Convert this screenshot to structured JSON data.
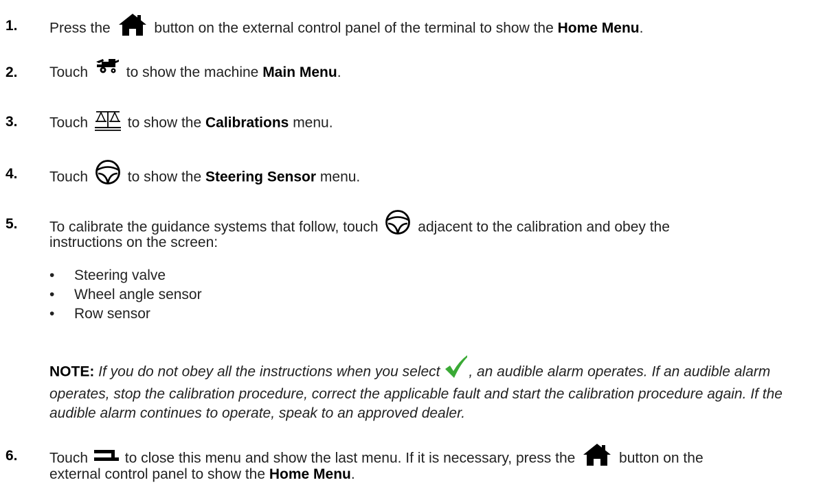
{
  "steps": [
    {
      "number": "1.",
      "parts": [
        "Press the",
        "button on the external control panel of the terminal to show the",
        "Home Menu",
        "."
      ],
      "icon": "home-icon"
    },
    {
      "number": "2.",
      "parts": [
        "Touch",
        "to show the machine",
        "Main Menu",
        "."
      ],
      "icon": "combine-harvester-icon"
    },
    {
      "number": "3.",
      "parts": [
        "Touch",
        "to show the",
        "Calibrations",
        "menu."
      ],
      "icon": "balance-scale-icon"
    },
    {
      "number": "4.",
      "parts": [
        "Touch",
        "to show the",
        "Steering Sensor",
        "menu."
      ],
      "icon": "steering-wheel-icon"
    },
    {
      "number": "5.",
      "parts": [
        "To calibrate the guidance systems that follow, touch",
        "adjacent to the calibration and obey the",
        "instructions on the screen:"
      ],
      "icon": "steering-wheel-icon",
      "bullets": [
        "Steering valve",
        "Wheel angle sensor",
        "Row sensor"
      ],
      "note": {
        "label": "NOTE:",
        "before_icon": "If you do not obey all the instructions when you select",
        "after_icon": ", an audible alarm operates. If an audible alarm operates, stop the calibration procedure, correct the applicable fault and start the calibration procedure again. If the audible alarm continues to operate, speak to an approved dealer.",
        "icon": "checkmark-icon"
      }
    },
    {
      "number": "6.",
      "parts": [
        "Touch",
        "to close this menu and show the last menu. If it is necessary, press the",
        "button on the",
        "external control panel to show the",
        "Home Menu",
        "."
      ],
      "icons": [
        "back-arrow-icon",
        "home-icon"
      ]
    }
  ],
  "colors": {
    "text": "#222222",
    "checkmark": "#3aaa35",
    "icon": "#000000"
  }
}
